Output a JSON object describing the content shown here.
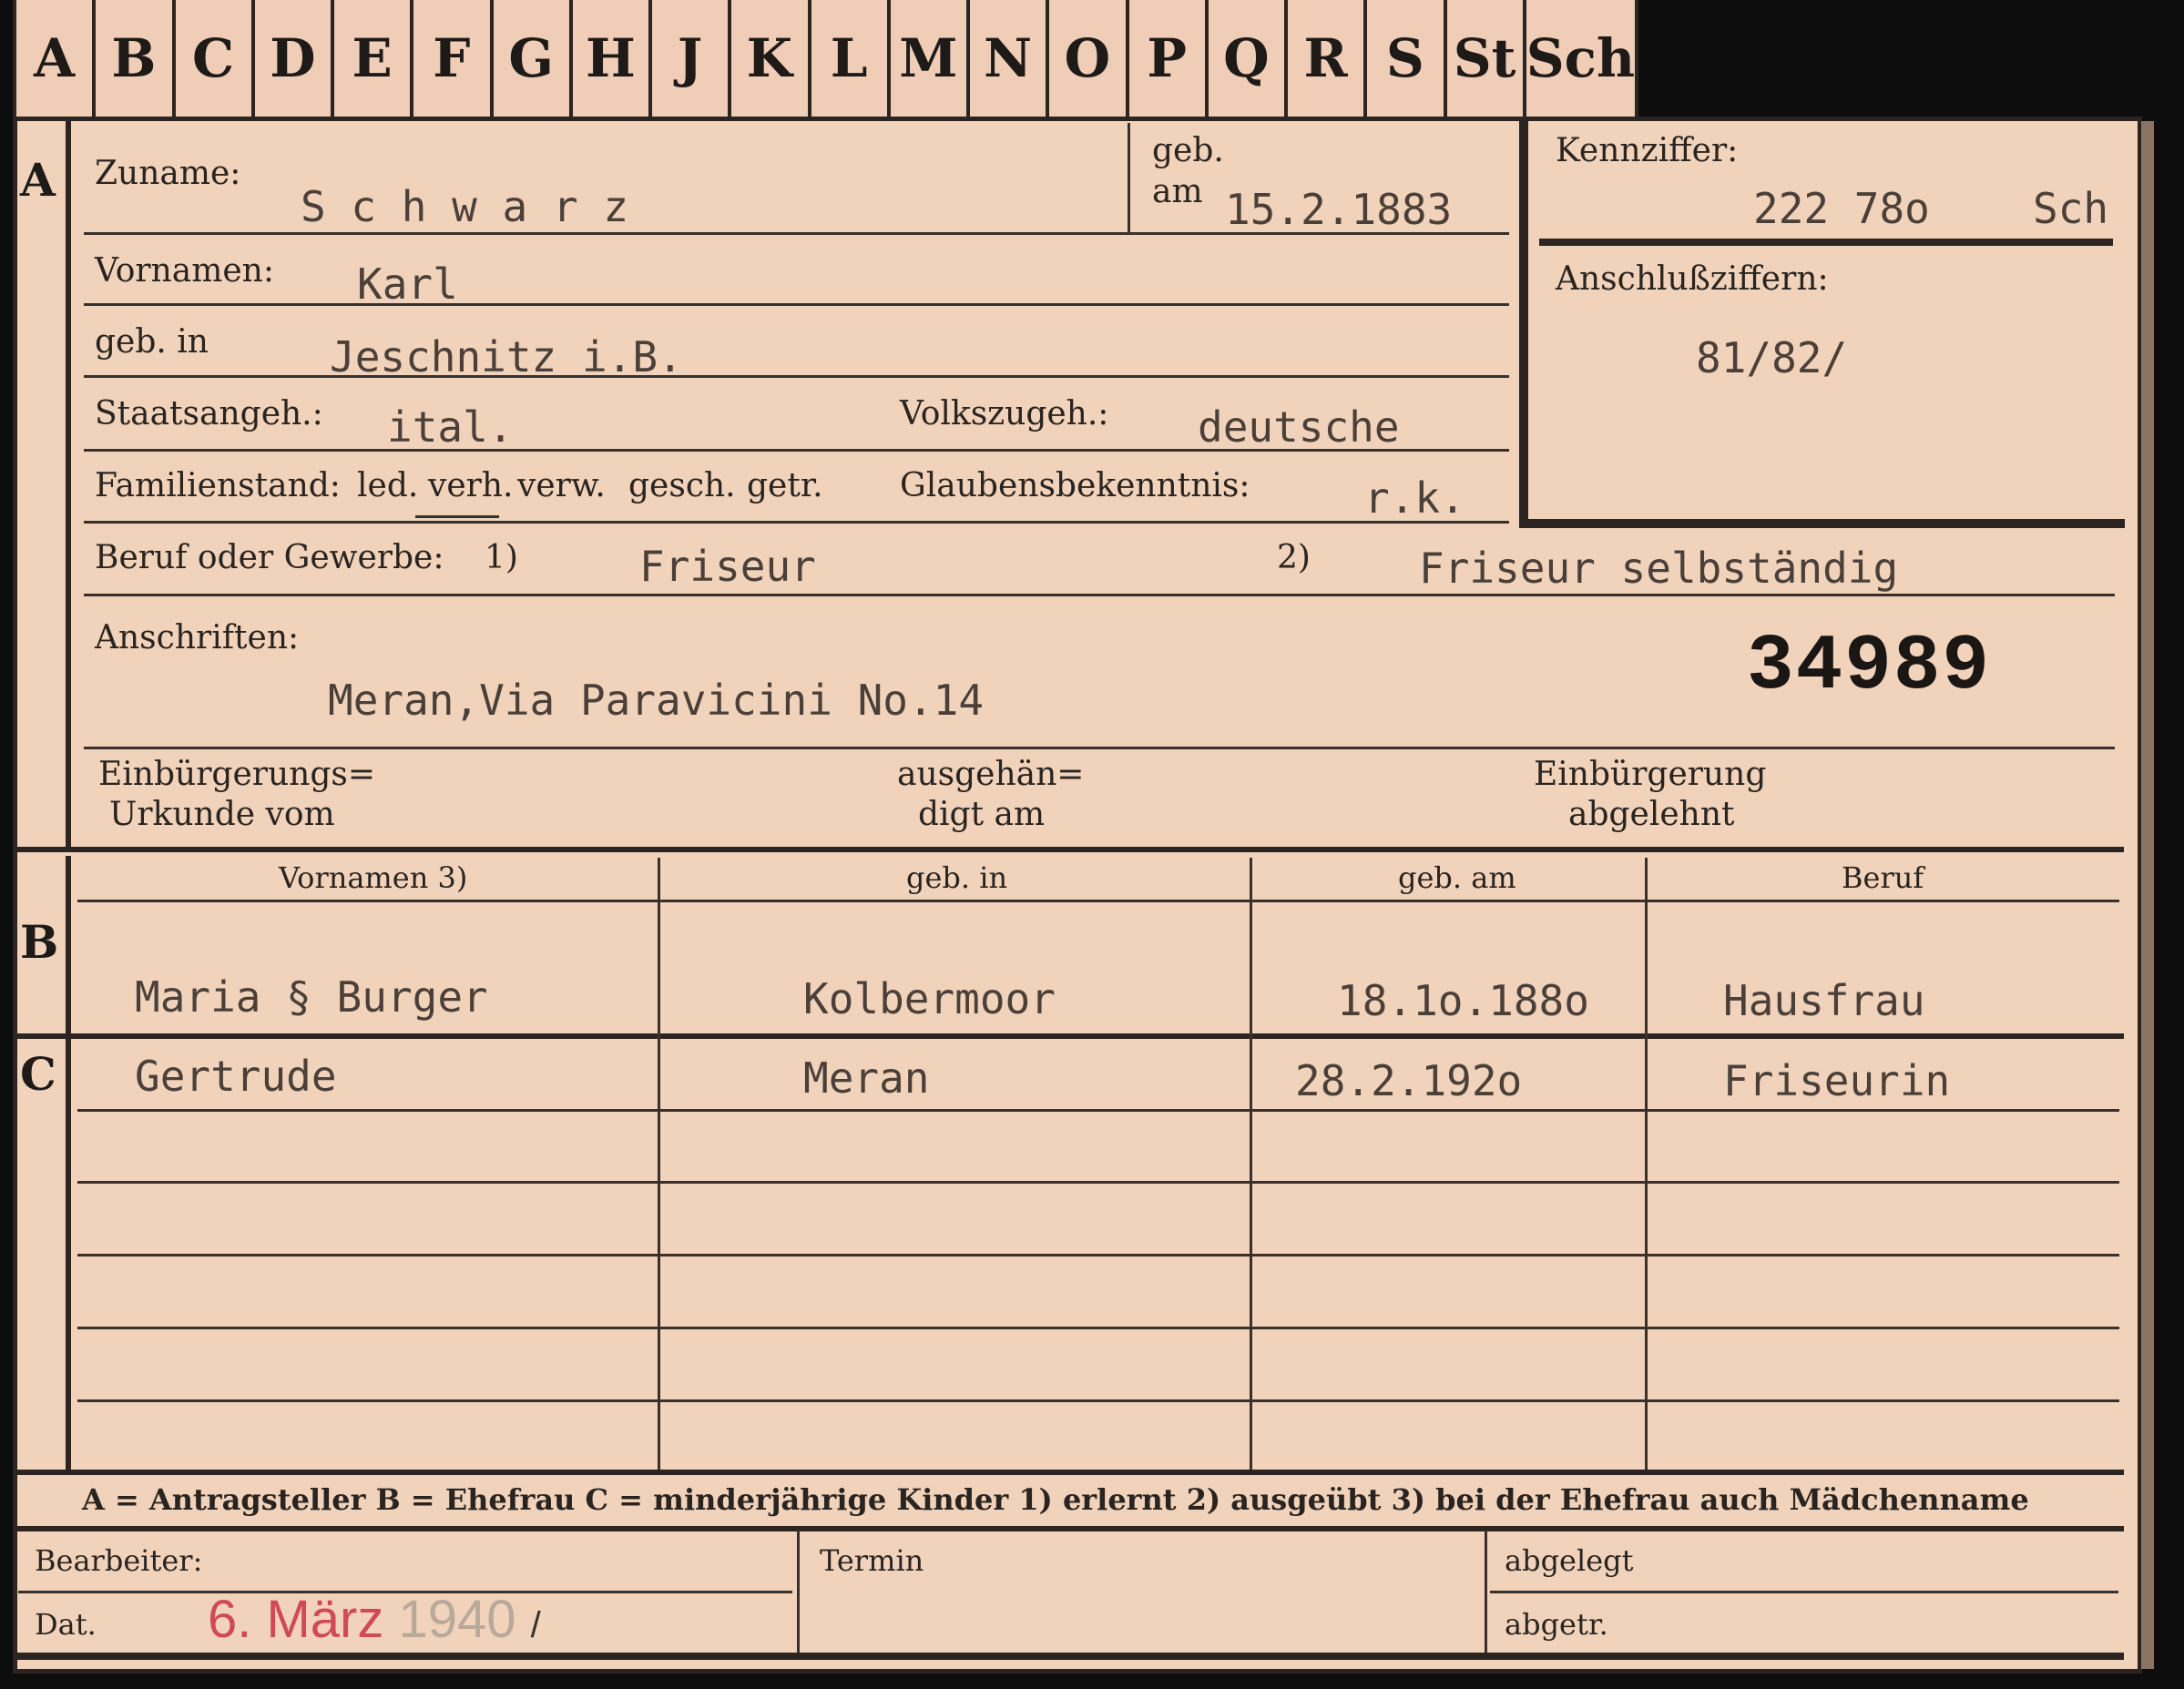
{
  "tabs": [
    "A",
    "B",
    "C",
    "D",
    "E",
    "F",
    "G",
    "H",
    "J",
    "K",
    "L",
    "M",
    "N",
    "O",
    "P",
    "Q",
    "R",
    "S",
    "St",
    "Sch"
  ],
  "section_a": {
    "letter": "A",
    "surname_label": "Zuname:",
    "surname_value": "S c h w a r z",
    "born_on_label_1": "geb.",
    "born_on_label_2": "am",
    "born_on_value": "15.2.1883",
    "firstnames_label": "Vornamen:",
    "firstnames_value": "Karl",
    "born_in_label": "geb. in",
    "born_in_value": "Jeschnitz i.B.",
    "citizenship_label": "Staatsangeh.:",
    "citizenship_value": "ital.",
    "ethnicity_label": "Volkszugeh.:",
    "ethnicity_value": "deutsche",
    "family_status_label": "Familienstand:",
    "family_status_options": [
      "led.",
      "verh.",
      "verw.",
      "gesch.",
      "getr."
    ],
    "religion_label": "Glaubensbekenntnis:",
    "religion_value": "r.k.",
    "occupation_label": "Beruf oder Gewerbe:",
    "footnote_1": "1)",
    "occupation_learned": "Friseur",
    "footnote_2": "2)",
    "occupation_practiced": "Friseur  selbständig",
    "addresses_label": "Anschriften:",
    "address_value": "Meran,Via Paravicini No.14",
    "record_number": "34989",
    "naturalization_doc_label_1": "Einbürgerungs=",
    "naturalization_doc_label_2": "Urkunde vom",
    "handed_out_label_1": "ausgehän=",
    "handed_out_label_2": "digt am",
    "naturalization_denied_label_1": "Einbürgerung",
    "naturalization_denied_label_2": "abgelehnt"
  },
  "id_box": {
    "code_label": "Kennziffer:",
    "code_value": "222 78o",
    "code_suffix": "Sch",
    "link_label": "Anschlußziffern:",
    "link_value": "81/82/"
  },
  "table": {
    "headers": [
      "Vornamen 3)",
      "geb. in",
      "geb. am",
      "Beruf"
    ],
    "section_b": {
      "letter": "B",
      "row": [
        "Maria § Burger",
        "Kolbermoor",
        "18.1o.188o",
        "Hausfrau"
      ]
    },
    "section_c": {
      "letter": "C",
      "row": [
        "Gertrude",
        "Meran",
        "28.2.192o",
        "Friseurin"
      ]
    }
  },
  "legend": "A = Antragsteller   B = Ehefrau   C = minderjährige Kinder   1) erlernt   2) ausgeübt   3) bei der Ehefrau auch Mädchenname",
  "footer": {
    "editor_label": "Bearbeiter:",
    "date_label": "Dat.",
    "stamp_date_red": "6. März",
    "stamp_year": "1940",
    "stamp_slash": "/",
    "deadline_label": "Termin",
    "filed_label": "abgelegt",
    "deregistered_label": "abgetr."
  }
}
